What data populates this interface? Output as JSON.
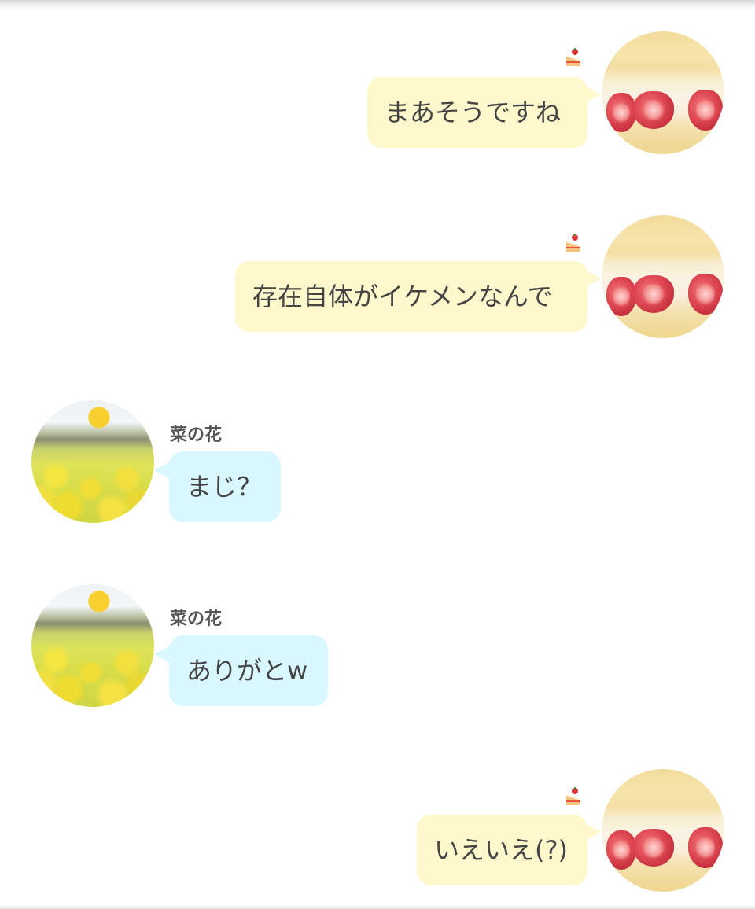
{
  "messages": [
    {
      "side": "mine",
      "text": "まあそうですね",
      "icon": "shortcake-icon"
    },
    {
      "side": "mine",
      "text": "存在自体がイケメンなんで",
      "icon": "shortcake-icon"
    },
    {
      "side": "theirs",
      "sender": "菜の花",
      "text": "まじ？"
    },
    {
      "side": "theirs",
      "sender": "菜の花",
      "text": "ありがとw"
    },
    {
      "side": "mine",
      "text": "いえいえ(?)",
      "icon": "shortcake-icon"
    }
  ],
  "colors": {
    "mine_bubble": "#fff8cc",
    "theirs_bubble": "#d8f7ff",
    "text": "#444444",
    "sender": "#555555",
    "background": "#ffffff"
  }
}
